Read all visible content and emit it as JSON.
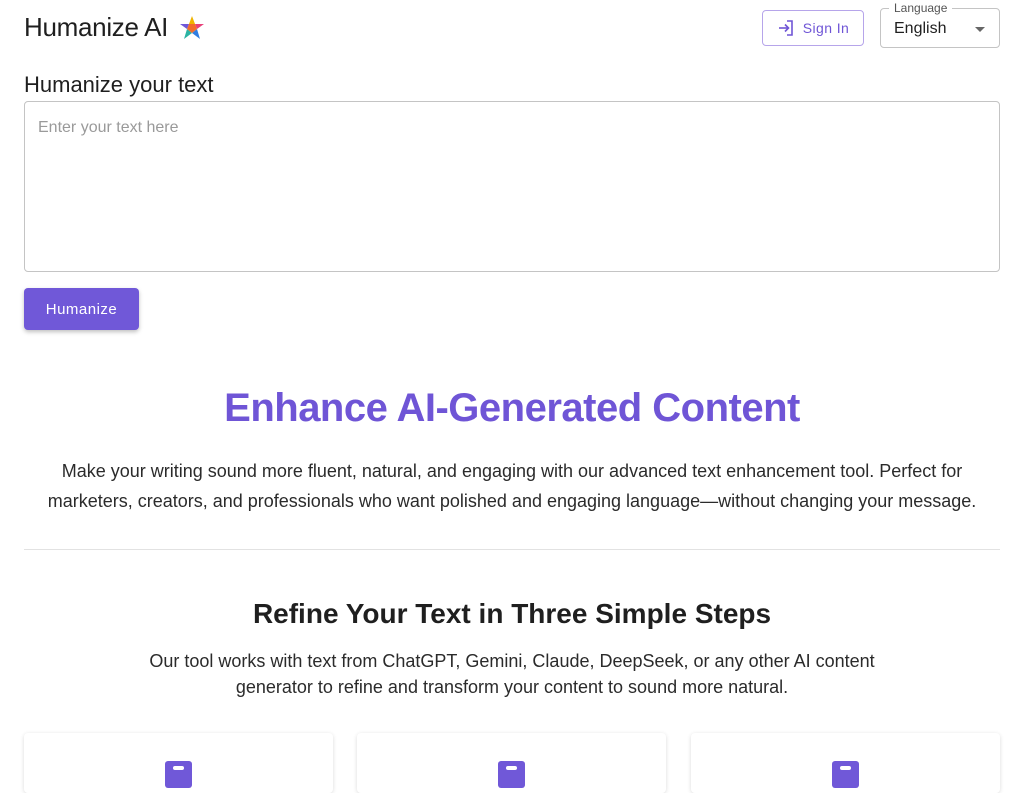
{
  "header": {
    "brand": "Humanize AI",
    "sign_in_label": "Sign In",
    "language_label": "Language",
    "language_value": "English"
  },
  "editor": {
    "label": "Humanize your text",
    "placeholder": "Enter your text here",
    "button_label": "Humanize"
  },
  "hero": {
    "title": "Enhance AI-Generated Content",
    "description": "Make your writing sound more fluent, natural, and engaging with our advanced text enhancement tool. Perfect for marketers, creators, and professionals who want polished and engaging language—without changing your message."
  },
  "steps": {
    "title": "Refine Your Text in Three Simple Steps",
    "description": "Our tool works with text from ChatGPT, Gemini, Claude, DeepSeek, or any other AI content generator to refine and transform your content to sound more natural."
  },
  "theme": {
    "accent": "#7058d8",
    "accent_text": "#6f55d6"
  },
  "icons": {
    "logo": "star-logo-icon",
    "sign_in": "login-icon",
    "select": "caret-down-icon",
    "step": "step-icon"
  }
}
